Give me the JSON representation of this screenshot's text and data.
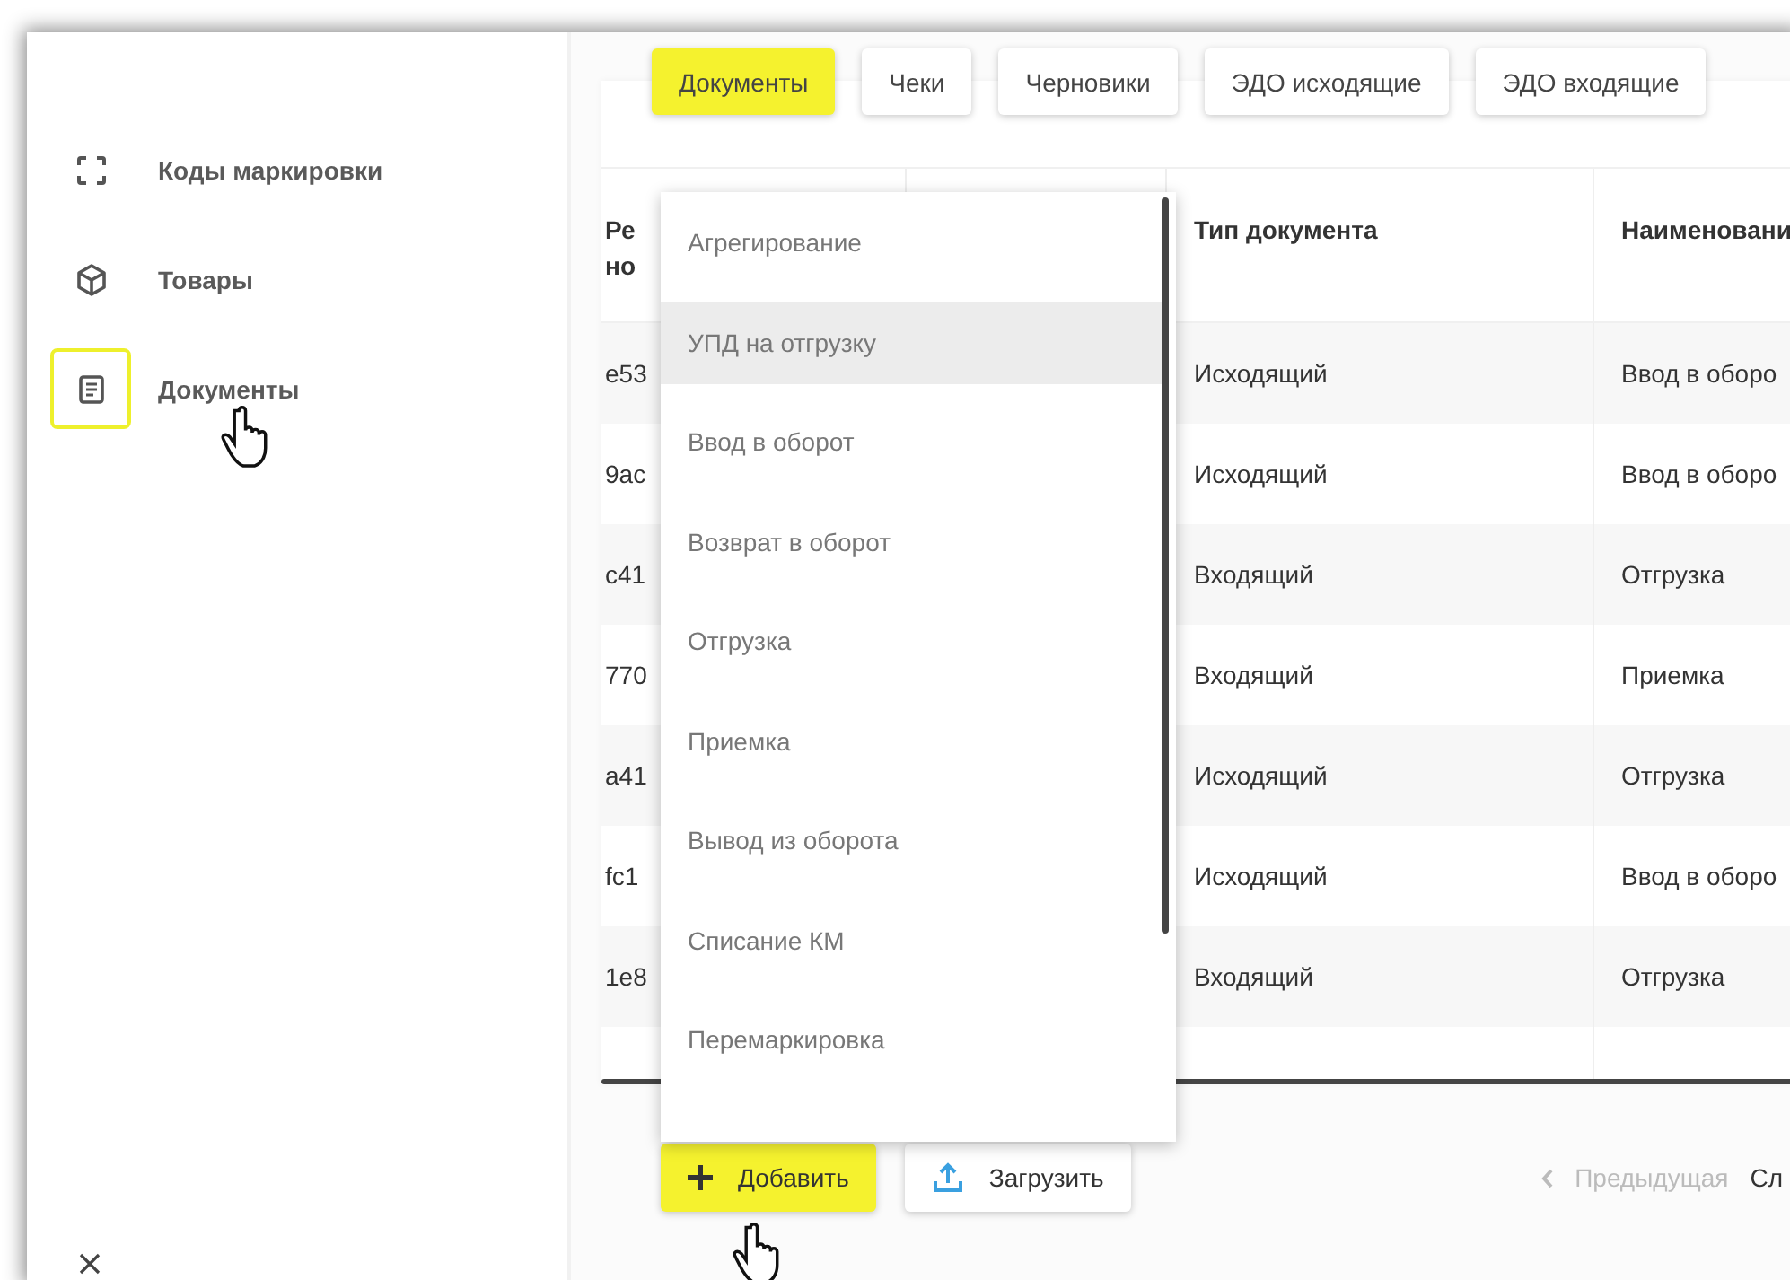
{
  "sidebar": {
    "items": [
      {
        "label": "Коды маркировки",
        "selected": false
      },
      {
        "label": "Товары",
        "selected": false
      },
      {
        "label": "Документы",
        "selected": true
      }
    ]
  },
  "tabs": [
    {
      "label": "Документы",
      "selected": true
    },
    {
      "label": "Чеки",
      "selected": false
    },
    {
      "label": "Черновики",
      "selected": false
    },
    {
      "label": "ЭДО исходящие",
      "selected": false
    },
    {
      "label": "ЭДО входящие",
      "selected": false
    }
  ],
  "table": {
    "columns": [
      "Ре но",
      "Тип документа",
      "Наименовани"
    ],
    "rows": [
      [
        "e53",
        "Исходящий",
        "Ввод в оборо"
      ],
      [
        "9ac",
        "Исходящий",
        "Ввод в оборо"
      ],
      [
        "c41",
        "Входящий",
        "Отгрузка"
      ],
      [
        "770",
        "Входящий",
        "Приемка"
      ],
      [
        "a41",
        "Исходящий",
        "Отгрузка"
      ],
      [
        "fc1",
        "Исходящий",
        "Ввод в оборо"
      ],
      [
        "1e8",
        "Входящий",
        "Отгрузка"
      ]
    ]
  },
  "add_menu": {
    "items": [
      {
        "label": "Агрегирование",
        "selected": false
      },
      {
        "label": "УПД на отгрузку",
        "selected": true
      },
      {
        "label": "Ввод в оборот",
        "selected": false
      },
      {
        "label": "Возврат в оборот",
        "selected": false
      },
      {
        "label": "Отгрузка",
        "selected": false
      },
      {
        "label": "Приемка",
        "selected": false
      },
      {
        "label": "Вывод из оборота",
        "selected": false
      },
      {
        "label": "Списание КМ",
        "selected": false
      },
      {
        "label": "Перемаркировка",
        "selected": false
      }
    ]
  },
  "footer": {
    "add_button": "Добавить",
    "upload_button": "Загрузить",
    "pagination": {
      "previous": {
        "label": "Предыдущая",
        "disabled": true
      },
      "next": "Сл"
    }
  }
}
